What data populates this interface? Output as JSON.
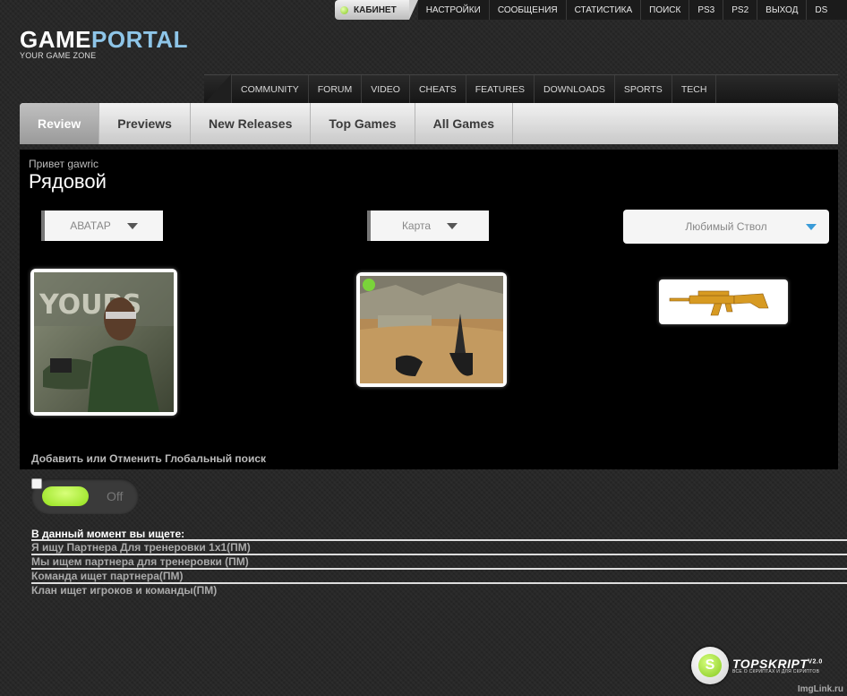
{
  "topbar": {
    "cabinet": "КАБИНЕТ",
    "links": [
      "НАСТРОЙКИ",
      "СООБЩЕНИЯ",
      "СТАТИСТИКА",
      "ПОИСК",
      "PS3",
      "PS2",
      "ВЫХОД",
      "DS"
    ]
  },
  "logo": {
    "game": "GAME",
    "portal": "PORTAL",
    "tagline": "YOUR GAME ZONE"
  },
  "catnav": [
    "COMMUNITY",
    "FORUM",
    "VIDEO",
    "CHEATS",
    "FEATURES",
    "DOWNLOADS",
    "SPORTS",
    "TECH"
  ],
  "tabs": [
    "Review",
    "Previews",
    "New Releases",
    "Top Games",
    "All Games"
  ],
  "profile": {
    "greeting": "Привет gawric",
    "rank": "Рядовой",
    "avatar_select": "АВАТАР",
    "map_select": "Карта",
    "weapon_select": "Любимый Ствол",
    "avatar_caption": "YOUPS"
  },
  "global_search": {
    "label": "Добавить или Отменить Глобальный поиск",
    "toggle_state": "Off"
  },
  "seeking": {
    "title": "В данный момент вы ищете:",
    "items": [
      "Я ищу Партнера Для тренеровки 1х1(ПМ)",
      "Мы ищем партнера для тренеровки (ПМ)",
      "Команда ищет партнера(ПМ)",
      "Клан ищет игроков и команды(ПМ)"
    ]
  },
  "footer": {
    "badge_letter": "S",
    "badge_brand": "TOPSKRIPT",
    "badge_version": "V2.0",
    "badge_sub": "ВСЕ О СКРИПТАХ И ДЛЯ СКРИПТОВ",
    "imglink": "ImgLink.ru"
  },
  "colors": {
    "accent_green": "#92e11a",
    "logo_blue": "#8ec5e8",
    "dropdown_arrow_blue": "#3a9bd8"
  }
}
